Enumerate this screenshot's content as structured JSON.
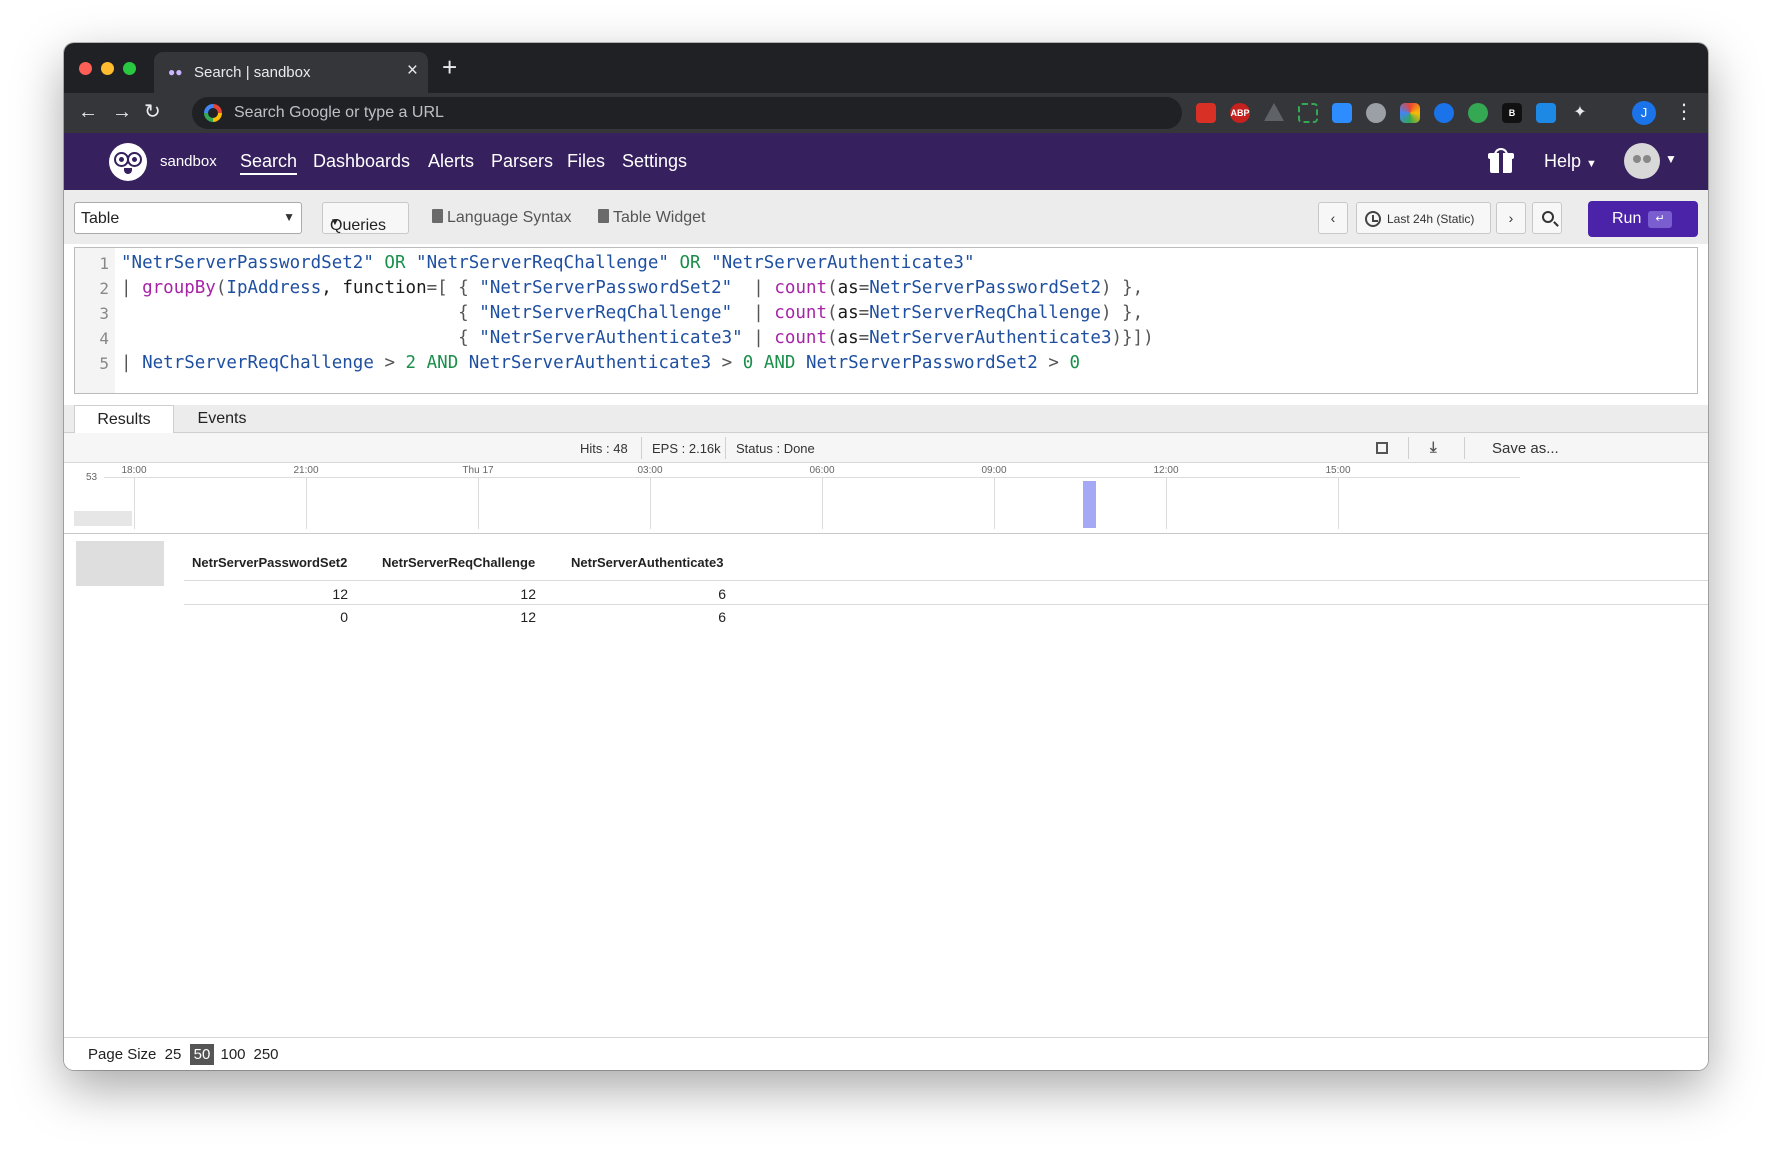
{
  "browser": {
    "tab_title": "Search | sandbox",
    "tab_close": "×",
    "new_tab": "+",
    "omnibox_placeholder": "Search Google or type a URL",
    "profile_initial": "J"
  },
  "app": {
    "repository": "sandbox",
    "nav": [
      "Search",
      "Dashboards",
      "Alerts",
      "Parsers",
      "Files",
      "Settings"
    ],
    "active_nav": "Search",
    "help": "Help"
  },
  "query_toolbar": {
    "widget_select": "Table",
    "queries": "Queries",
    "language_syntax": "Language Syntax",
    "table_widget": "Table Widget",
    "time_range": "Last 24h (Static)",
    "run": "Run",
    "enter_key": "↵"
  },
  "editor": {
    "line_numbers": [
      "1",
      "2",
      "3",
      "4",
      "5"
    ]
  },
  "results": {
    "tabs": [
      "Results",
      "Events"
    ],
    "active_tab": "Results",
    "hits": "Hits : 48",
    "eps": "EPS : 2.16k",
    "status": "Status : Done",
    "save_as": "Save as..."
  },
  "histogram": {
    "y_max_label": "53",
    "x_labels": [
      "18:00",
      "21:00",
      "Thu 17",
      "03:00",
      "06:00",
      "09:00",
      "12:00",
      "15:00"
    ],
    "bar_color": "#a5a8f5"
  },
  "table": {
    "columns": [
      "NetrServerPasswordSet2",
      "NetrServerReqChallenge",
      "NetrServerAuthenticate3"
    ],
    "rows": [
      [
        "12",
        "12",
        "6"
      ],
      [
        "0",
        "12",
        "6"
      ]
    ]
  },
  "pagination": {
    "label": "Page Size",
    "options": [
      "25",
      "50",
      "100",
      "250"
    ],
    "selected": "50"
  },
  "colors": {
    "app_header": "#36205e",
    "run_button": "#4b23a8"
  }
}
